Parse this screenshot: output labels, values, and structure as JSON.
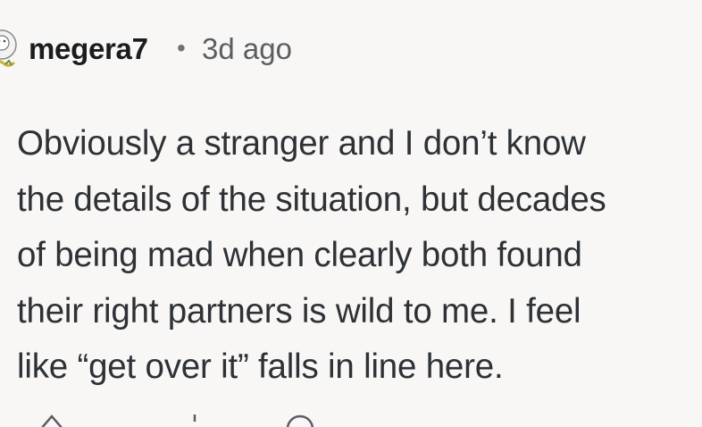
{
  "comment": {
    "username": "megera7",
    "separator": "•",
    "timestamp": "3d ago",
    "text": "Obviously a stranger and I don’t know\nthe details of the situation, but decades\nof being mad when clearly both found\ntheir right partners is wild to me. I feel\nlike “get over it” falls in line here.",
    "avatar_icon": "user-avatar-icon"
  },
  "actions": {
    "icons": [
      "upvote-icon",
      "downvote-icon",
      "reply-icon"
    ]
  }
}
